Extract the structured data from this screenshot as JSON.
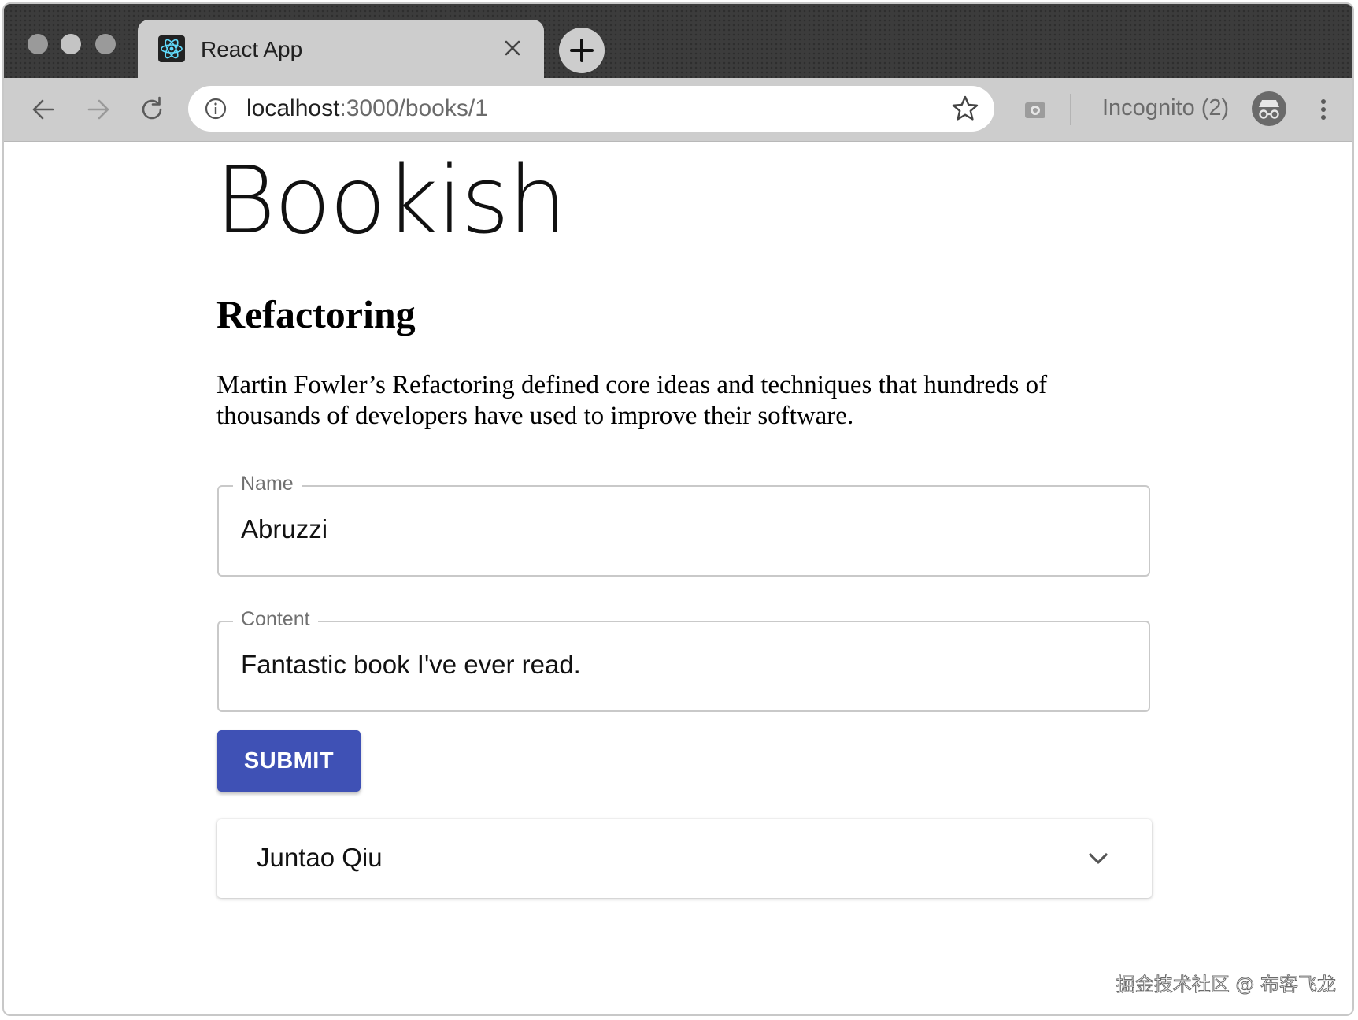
{
  "browser": {
    "tab": {
      "title": "React App",
      "favicon": "react-logo-icon"
    },
    "new_tab_icon": "plus-icon",
    "url": {
      "host": "localhost",
      "rest": ":3000/books/1"
    },
    "incognito_label": "Incognito (2)",
    "icons": [
      "back-arrow-icon",
      "forward-arrow-icon",
      "reload-icon",
      "info-icon",
      "star-icon",
      "camera-icon",
      "incognito-icon",
      "more-vert-icon"
    ]
  },
  "page": {
    "app_title": "Bookish",
    "book": {
      "title": "Refactoring",
      "description": "Martin Fowler’s Refactoring defined core ideas and techniques that hundreds of thousands of developers have used to improve their software."
    },
    "form": {
      "name_label": "Name",
      "name_value": "Abruzzi",
      "content_label": "Content",
      "content_value": "Fantastic book I've ever read.",
      "submit_label": "SUBMIT"
    },
    "review": {
      "reviewer": "Juntao Qiu"
    },
    "accent_color": "#3f51b5"
  },
  "watermark": "掘金技术社区 @ 布客飞龙"
}
